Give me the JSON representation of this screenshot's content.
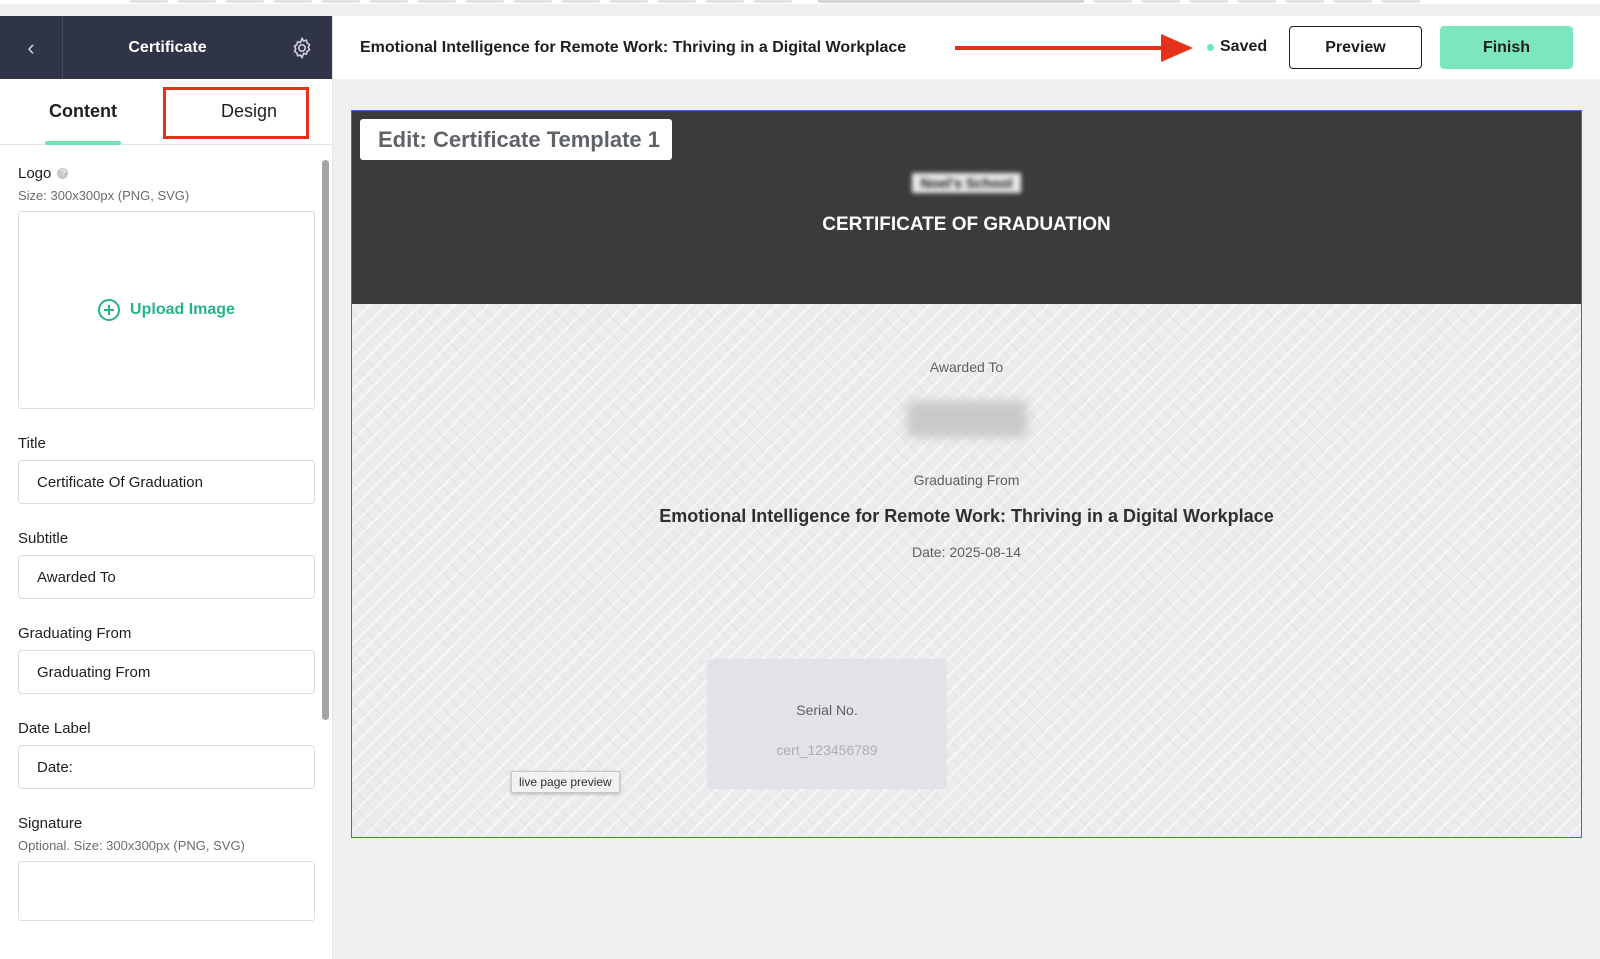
{
  "sidebar": {
    "title": "Certificate",
    "tabs": [
      {
        "label": "Content",
        "active": true
      },
      {
        "label": "Design",
        "active": false
      }
    ],
    "logo": {
      "label": "Logo",
      "hint": "Size: 300x300px (PNG, SVG)",
      "upload_label": "Upload Image"
    },
    "title_field": {
      "label": "Title",
      "value": "Certificate Of Graduation"
    },
    "subtitle_field": {
      "label": "Subtitle",
      "value": "Awarded To"
    },
    "graduating_field": {
      "label": "Graduating From",
      "value": "Graduating From"
    },
    "date_field": {
      "label": "Date Label",
      "value": "Date:"
    },
    "signature": {
      "label": "Signature",
      "hint": "Optional. Size: 300x300px (PNG, SVG)"
    }
  },
  "topbar": {
    "doc_title": "Emotional Intelligence for Remote Work: Thriving in a Digital Workplace",
    "status": "Saved",
    "preview_label": "Preview",
    "finish_label": "Finish"
  },
  "certificate": {
    "edit_label": "Edit: Certificate Template 1",
    "school_name": "Noel's School",
    "title": "CERTIFICATE OF GRADUATION",
    "awarded_to": "Awarded To",
    "recipient": "",
    "graduating_from": "Graduating From",
    "course": "Emotional Intelligence for Remote Work: Thriving in a Digital Workplace",
    "date": "Date: 2025-08-14",
    "serial_label": "Serial No.",
    "serial_value": "cert_123456789",
    "tooltip": "live page preview"
  },
  "colors": {
    "sidebar_header": "#2f3449",
    "accent": "#6ee7b7",
    "finish_button": "#7ce6bc",
    "annotation_red": "#e5301a",
    "cert_header": "#3b3b3d"
  }
}
